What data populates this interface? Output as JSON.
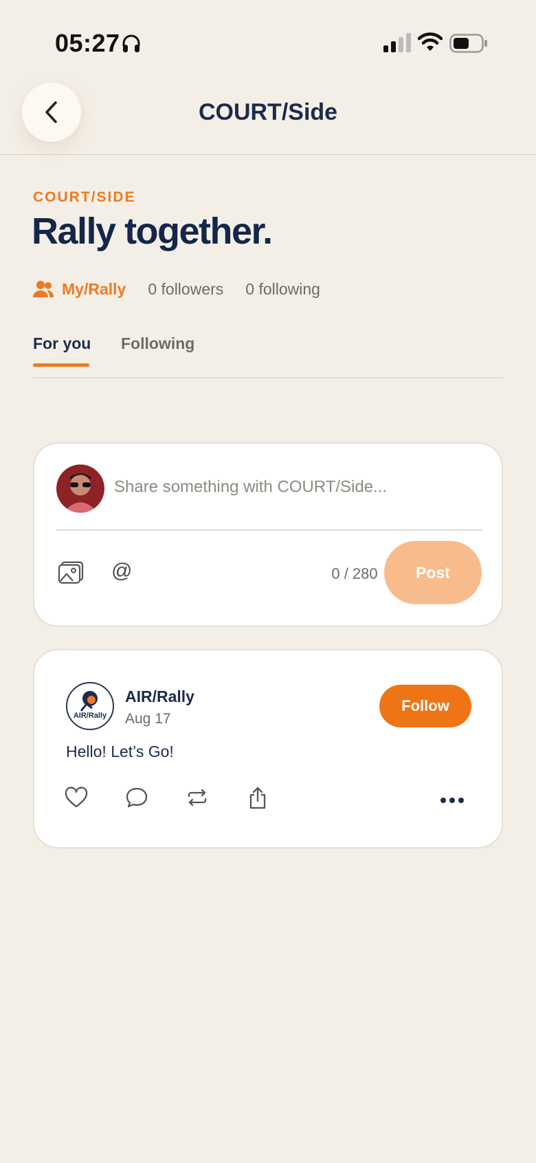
{
  "status_bar": {
    "time": "05:27"
  },
  "header": {
    "title": "COURT/Side"
  },
  "hero": {
    "eyebrow": "COURT/SIDE",
    "title": "Rally together."
  },
  "meta": {
    "my_rally": "My/Rally",
    "followers": "0 followers",
    "following": "0 following"
  },
  "tabs": [
    {
      "label": "For you",
      "active": true
    },
    {
      "label": "Following",
      "active": false
    }
  ],
  "composer": {
    "placeholder": "Share something with COURT/Side...",
    "value": "",
    "char_count": "0 / 280",
    "post_label": "Post"
  },
  "post": {
    "author": "AIR/Rally",
    "date": "Aug 17",
    "body": "Hello! Let’s Go!",
    "follow_label": "Follow",
    "logo_text": "AIR/Rally"
  },
  "colors": {
    "accent": "#ee7a22",
    "navy": "#1b2b4b",
    "background": "#f4efe6",
    "post_disabled": "#f7bb8c"
  }
}
